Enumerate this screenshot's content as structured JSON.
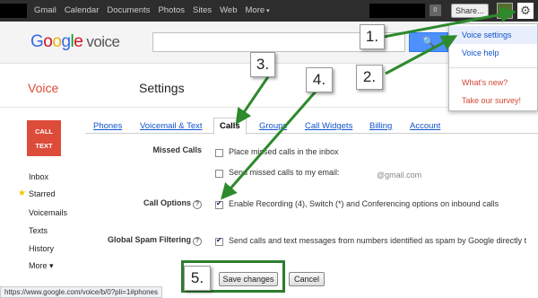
{
  "topbar": {
    "nav": [
      "Gmail",
      "Calendar",
      "Documents",
      "Photos",
      "Sites",
      "Web",
      "More"
    ],
    "count": "0",
    "share_label": "Share..."
  },
  "header": {
    "logo_letters": [
      "G",
      "o",
      "o",
      "g",
      "l",
      "e"
    ],
    "logo_product": "voice",
    "search_value": "",
    "search_button": "🔍"
  },
  "page": {
    "app_name": "Voice",
    "title": "Settings"
  },
  "sidebar": {
    "call_button": [
      "CALL",
      "TEXT"
    ],
    "items": [
      "Inbox",
      "Starred",
      "Voicemails",
      "Texts",
      "History",
      "More ▾"
    ]
  },
  "tabs": [
    "Phones",
    "Voicemail & Text",
    "Calls",
    "Groups",
    "Call Widgets",
    "Billing",
    "Account"
  ],
  "active_tab": "Calls",
  "settings": {
    "missed_calls_label": "Missed Calls",
    "missed_inbox": "Place missed calls in the inbox",
    "missed_email": "Send missed calls to my email:",
    "email_suffix": "@gmail.com",
    "call_options_label": "Call Options",
    "call_options_text": "Enable Recording (4), Switch (*) and Conferencing options on inbound calls",
    "spam_label": "Global Spam Filtering",
    "spam_text": "Send calls and text messages from numbers identified as spam by Google directly t",
    "help_glyph": "?",
    "checked": {
      "missed_inbox": false,
      "missed_email": false,
      "call_options": true,
      "spam": true
    }
  },
  "buttons": {
    "save": "Save changes",
    "cancel": "Cancel"
  },
  "status_url": "https://www.google.com/voice/b/0?pli=1#phones",
  "dropdown": {
    "items": [
      "Voice settings",
      "Voice help",
      "What's new?",
      "Take our survey!"
    ]
  },
  "callouts": [
    "1.",
    "2.",
    "3.",
    "4.",
    "5."
  ],
  "colors": {
    "accent_red": "#dd4b39",
    "link_blue": "#15c",
    "arrow_green": "#2d8a2d"
  }
}
